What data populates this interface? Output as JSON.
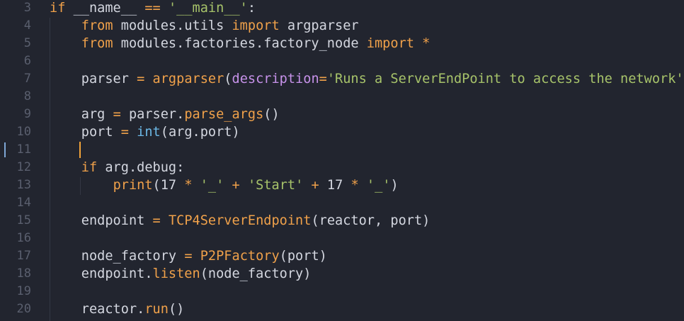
{
  "editor": {
    "current_line": 11,
    "colors": {
      "background": "#22252f",
      "keyword": "#f0a14a",
      "string": "#a7c36a",
      "builtin": "#6cb8e6",
      "param": "#c792ea",
      "text": "#d4d7e0",
      "line_number": "#5a5f6e",
      "cursor": "#f2a33a"
    },
    "lines": [
      {
        "n": "3",
        "tokens": [
          [
            "kw",
            "if"
          ],
          [
            "plain",
            " __name__ "
          ],
          [
            "op",
            "=="
          ],
          [
            "plain",
            " "
          ],
          [
            "str",
            "'__main__'"
          ],
          [
            "plain",
            ":"
          ]
        ]
      },
      {
        "n": "4",
        "tokens": [
          [
            "plain",
            "    "
          ],
          [
            "kw",
            "from"
          ],
          [
            "plain",
            " modules.utils "
          ],
          [
            "kw",
            "import"
          ],
          [
            "plain",
            " argparser"
          ]
        ]
      },
      {
        "n": "5",
        "tokens": [
          [
            "plain",
            "    "
          ],
          [
            "kw",
            "from"
          ],
          [
            "plain",
            " modules.factories.factory_node "
          ],
          [
            "kw",
            "import"
          ],
          [
            "plain",
            " "
          ],
          [
            "op",
            "*"
          ]
        ]
      },
      {
        "n": "6",
        "tokens": []
      },
      {
        "n": "7",
        "tokens": [
          [
            "plain",
            "    parser "
          ],
          [
            "op",
            "="
          ],
          [
            "plain",
            " "
          ],
          [
            "fn",
            "argparser"
          ],
          [
            "plain",
            "("
          ],
          [
            "param",
            "description"
          ],
          [
            "op",
            "="
          ],
          [
            "str",
            "'Runs a ServerEndPoint to access the network'"
          ],
          [
            "plain",
            ")"
          ]
        ]
      },
      {
        "n": "8",
        "tokens": []
      },
      {
        "n": "9",
        "tokens": [
          [
            "plain",
            "    arg "
          ],
          [
            "op",
            "="
          ],
          [
            "plain",
            " parser."
          ],
          [
            "fn",
            "parse_args"
          ],
          [
            "plain",
            "()"
          ]
        ]
      },
      {
        "n": "10",
        "tokens": [
          [
            "plain",
            "    port "
          ],
          [
            "op",
            "="
          ],
          [
            "plain",
            " "
          ],
          [
            "builtin",
            "int"
          ],
          [
            "plain",
            "(arg.port)"
          ]
        ]
      },
      {
        "n": "11",
        "tokens": []
      },
      {
        "n": "12",
        "tokens": [
          [
            "plain",
            "    "
          ],
          [
            "kw",
            "if"
          ],
          [
            "plain",
            " arg.debug:"
          ]
        ]
      },
      {
        "n": "13",
        "tokens": [
          [
            "plain",
            "        "
          ],
          [
            "fn",
            "print"
          ],
          [
            "plain",
            "(17 "
          ],
          [
            "op",
            "*"
          ],
          [
            "plain",
            " "
          ],
          [
            "str",
            "'_'"
          ],
          [
            "plain",
            " "
          ],
          [
            "op",
            "+"
          ],
          [
            "plain",
            " "
          ],
          [
            "str",
            "'Start'"
          ],
          [
            "plain",
            " "
          ],
          [
            "op",
            "+"
          ],
          [
            "plain",
            " 17 "
          ],
          [
            "op",
            "*"
          ],
          [
            "plain",
            " "
          ],
          [
            "str",
            "'_'"
          ],
          [
            "plain",
            ")"
          ]
        ]
      },
      {
        "n": "14",
        "tokens": []
      },
      {
        "n": "15",
        "tokens": [
          [
            "plain",
            "    endpoint "
          ],
          [
            "op",
            "="
          ],
          [
            "plain",
            " "
          ],
          [
            "cls",
            "TCP4ServerEndpoint"
          ],
          [
            "plain",
            "(reactor, port)"
          ]
        ]
      },
      {
        "n": "16",
        "tokens": []
      },
      {
        "n": "17",
        "tokens": [
          [
            "plain",
            "    node_factory "
          ],
          [
            "op",
            "="
          ],
          [
            "plain",
            " "
          ],
          [
            "cls",
            "P2PFactory"
          ],
          [
            "plain",
            "(port)"
          ]
        ]
      },
      {
        "n": "18",
        "tokens": [
          [
            "plain",
            "    endpoint."
          ],
          [
            "fn",
            "listen"
          ],
          [
            "plain",
            "(node_factory)"
          ]
        ]
      },
      {
        "n": "19",
        "tokens": []
      },
      {
        "n": "20",
        "tokens": [
          [
            "plain",
            "    reactor."
          ],
          [
            "fn",
            "run"
          ],
          [
            "plain",
            "()"
          ]
        ]
      }
    ]
  }
}
